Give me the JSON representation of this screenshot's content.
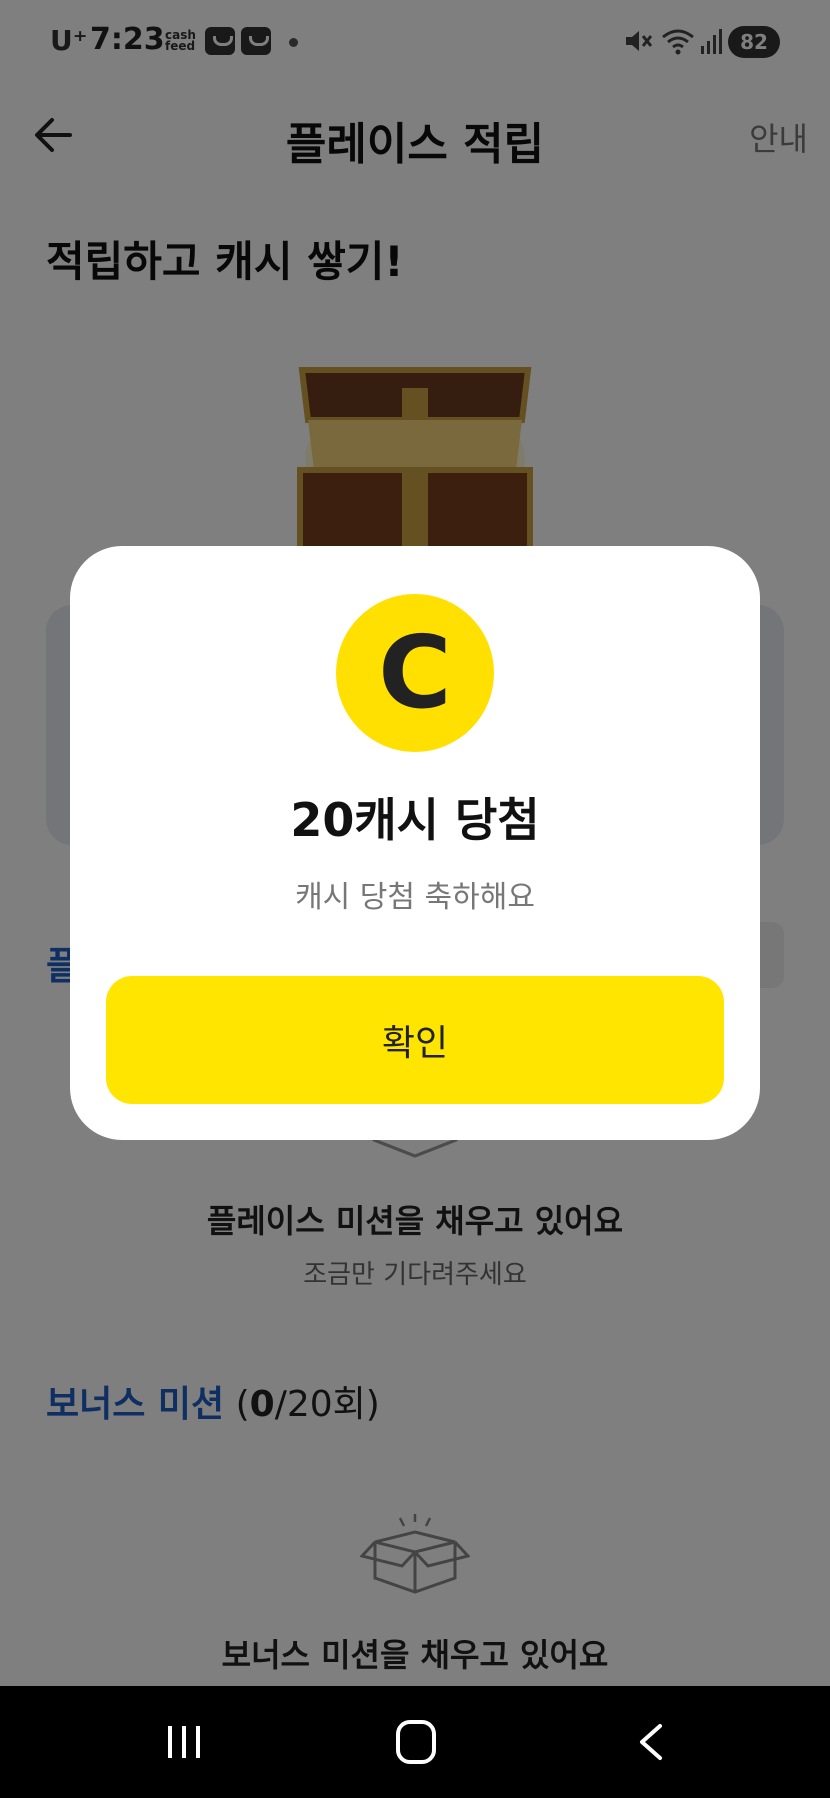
{
  "status_bar": {
    "carrier": "U⁺",
    "time": "7:23",
    "cashfeed": "cash\nfeed",
    "battery": "82"
  },
  "header": {
    "title": "플레이스 적립",
    "info_label": "안내"
  },
  "main": {
    "headline": "적립하고 캐시 쌓기!",
    "section_partial": "플",
    "place_empty_title": "플레이스 미션을 채우고 있어요",
    "place_empty_subtitle": "조금만 기다려주세요",
    "bonus_title": "보너스 미션",
    "bonus_count_open": " (",
    "bonus_count_done": "0",
    "bonus_count_total": "/20회)",
    "bonus_empty_title": "보너스 미션을 채우고 있어요"
  },
  "modal": {
    "coin_letter": "C",
    "title": "20캐시 당첨",
    "subtitle": "캐시 당첨 축하해요",
    "confirm_label": "확인"
  },
  "colors": {
    "accent_yellow": "#ffe500",
    "section_blue": "#1f5fc5"
  },
  "icons": [
    "back-arrow-icon",
    "treasure-chest-icon",
    "empty-box-icon",
    "coin-icon",
    "recent-apps-icon",
    "home-icon",
    "nav-back-icon"
  ]
}
